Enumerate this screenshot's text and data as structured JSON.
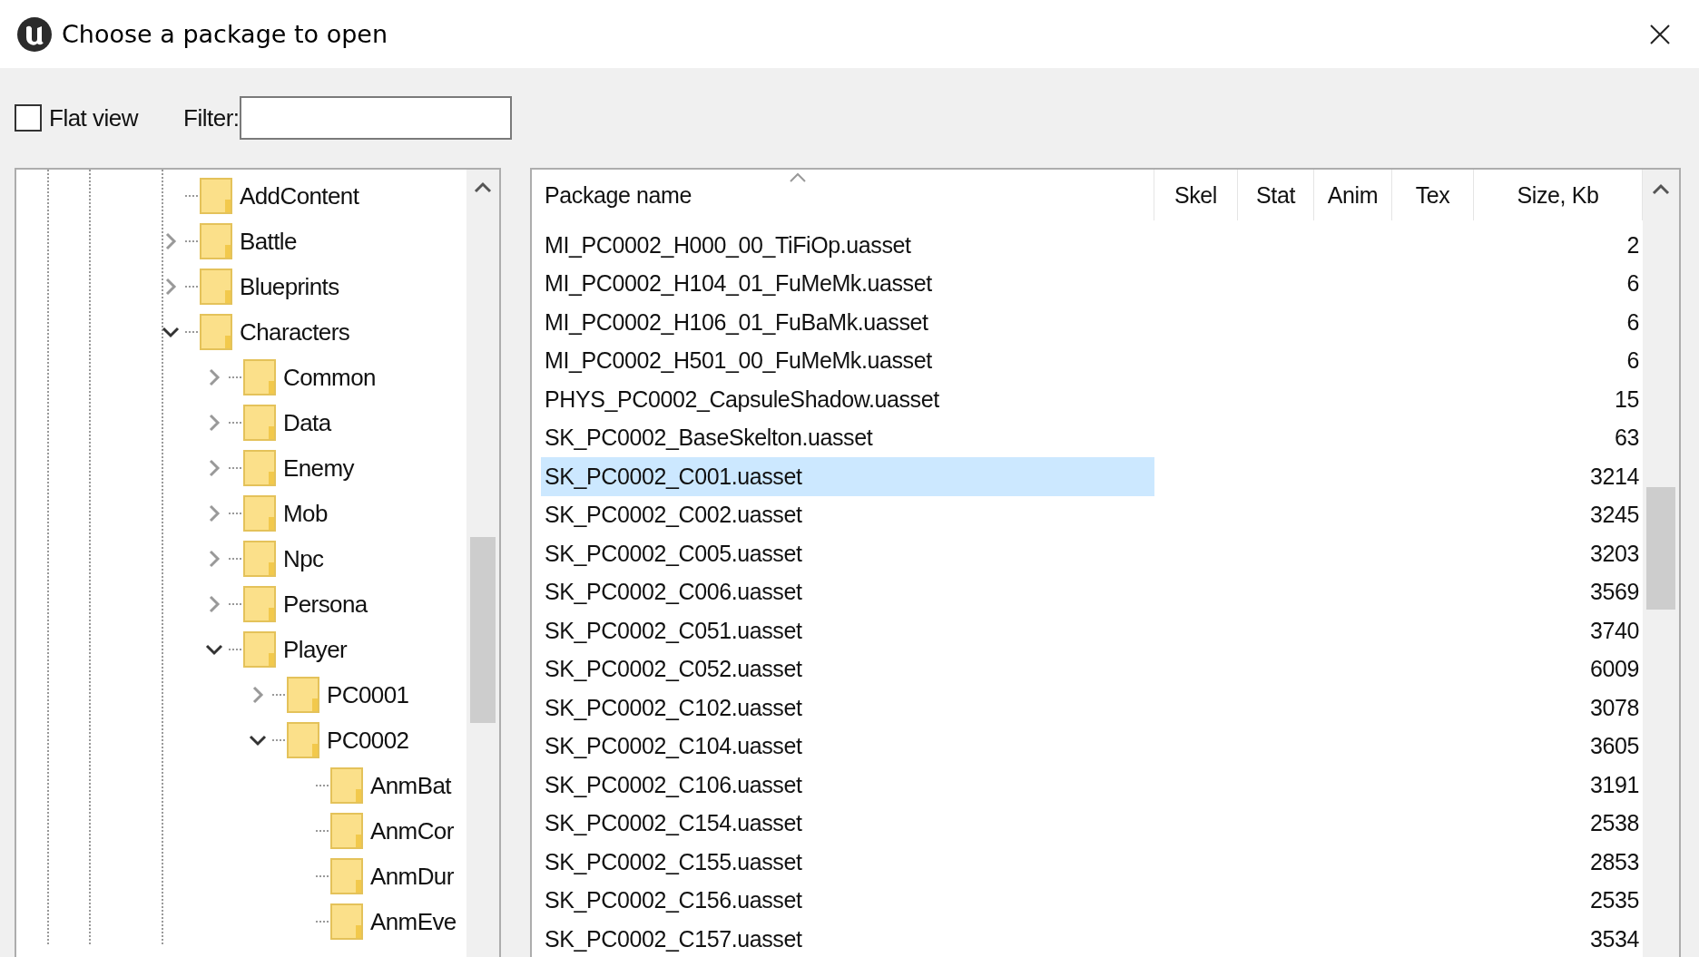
{
  "window": {
    "title": "Choose a package to open"
  },
  "toolbar": {
    "flat_view": {
      "label": "Flat view",
      "checked": false
    },
    "filter": {
      "label": "Filter:"
    }
  },
  "tree": [
    {
      "label": "AddContent"
    },
    {
      "label": "Battle",
      "expanded": false
    },
    {
      "label": "Blueprints",
      "expanded": false
    },
    {
      "label": "Characters",
      "expanded": true,
      "children": [
        {
          "label": "Common",
          "expanded": false
        },
        {
          "label": "Data",
          "expanded": false
        },
        {
          "label": "Enemy",
          "expanded": false
        },
        {
          "label": "Mob",
          "expanded": false
        },
        {
          "label": "Npc",
          "expanded": false
        },
        {
          "label": "Persona",
          "expanded": false
        },
        {
          "label": "Player",
          "expanded": true,
          "children": [
            {
              "label": "PC0001",
              "expanded": false
            },
            {
              "label": "PC0002",
              "expanded": true,
              "children": [
                {
                  "label": "AnmBat"
                },
                {
                  "label": "AnmCor"
                },
                {
                  "label": "AnmDur"
                },
                {
                  "label": "AnmEve"
                }
              ]
            }
          ]
        }
      ]
    }
  ],
  "table": {
    "columns": [
      "Package name",
      "Skel",
      "Stat",
      "Anim",
      "Tex",
      "Size, Kb"
    ],
    "rows": [
      {
        "name": "MI_PC0002_H000_00_TiFiOp.uasset",
        "size": "2",
        "selected": false
      },
      {
        "name": "MI_PC0002_H104_01_FuMeMk.uasset",
        "size": "6",
        "selected": false
      },
      {
        "name": "MI_PC0002_H106_01_FuBaMk.uasset",
        "size": "6",
        "selected": false
      },
      {
        "name": "MI_PC0002_H501_00_FuMeMk.uasset",
        "size": "6",
        "selected": false
      },
      {
        "name": "PHYS_PC0002_CapsuleShadow.uasset",
        "size": "15",
        "selected": false
      },
      {
        "name": "SK_PC0002_BaseSkelton.uasset",
        "size": "63",
        "selected": false
      },
      {
        "name": "SK_PC0002_C001.uasset",
        "size": "3214",
        "selected": true
      },
      {
        "name": "SK_PC0002_C002.uasset",
        "size": "3245",
        "selected": false
      },
      {
        "name": "SK_PC0002_C005.uasset",
        "size": "3203",
        "selected": false
      },
      {
        "name": "SK_PC0002_C006.uasset",
        "size": "3569",
        "selected": false
      },
      {
        "name": "SK_PC0002_C051.uasset",
        "size": "3740",
        "selected": false
      },
      {
        "name": "SK_PC0002_C052.uasset",
        "size": "6009",
        "selected": false
      },
      {
        "name": "SK_PC0002_C102.uasset",
        "size": "3078",
        "selected": false
      },
      {
        "name": "SK_PC0002_C104.uasset",
        "size": "3605",
        "selected": false
      },
      {
        "name": "SK_PC0002_C106.uasset",
        "size": "3191",
        "selected": false
      },
      {
        "name": "SK_PC0002_C154.uasset",
        "size": "2538",
        "selected": false
      },
      {
        "name": "SK_PC0002_C155.uasset",
        "size": "2853",
        "selected": false
      },
      {
        "name": "SK_PC0002_C156.uasset",
        "size": "2535",
        "selected": false
      },
      {
        "name": "SK_PC0002_C157.uasset",
        "size": "3534",
        "selected": false
      }
    ]
  }
}
